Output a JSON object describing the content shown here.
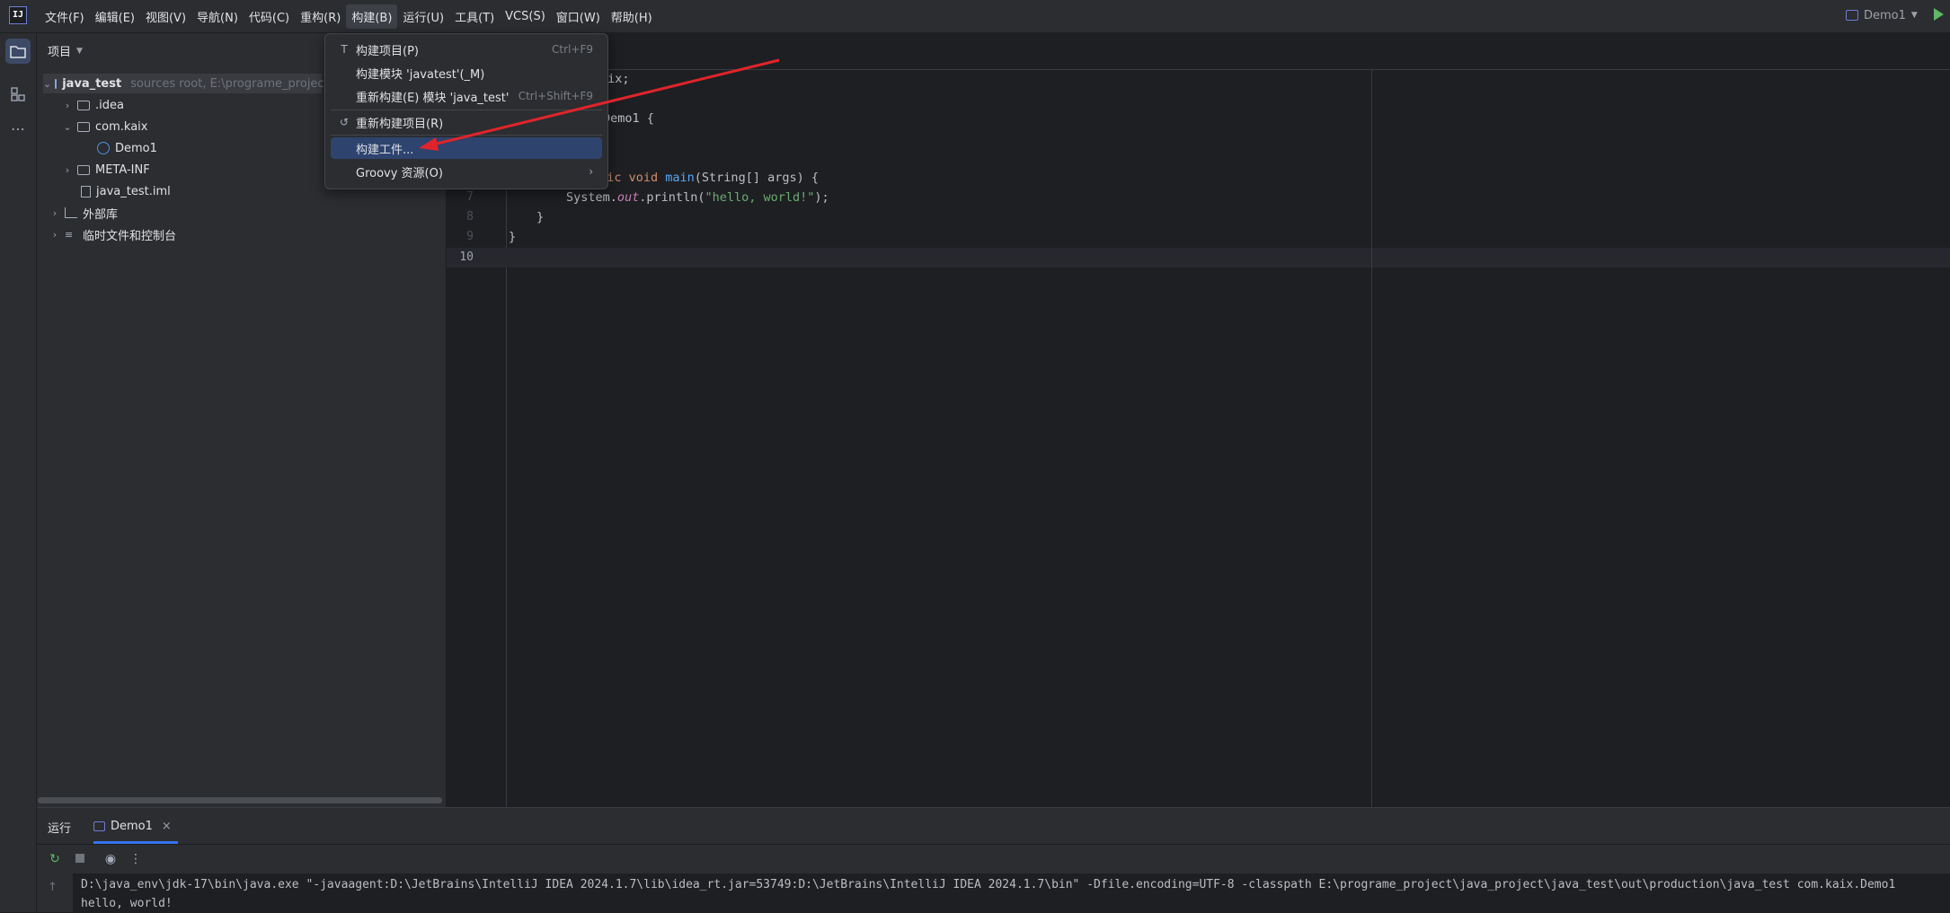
{
  "app": {
    "logo_text": "IJ"
  },
  "menu": {
    "items": [
      "文件(F)",
      "编辑(E)",
      "视图(V)",
      "导航(N)",
      "代码(C)",
      "重构(R)",
      "构建(B)",
      "运行(U)",
      "工具(T)",
      "VCS(S)",
      "窗口(W)",
      "帮助(H)"
    ],
    "active_index": 6
  },
  "run_config": {
    "label": "Demo1"
  },
  "project_panel": {
    "title": "项目",
    "tree": [
      {
        "label": "java_test",
        "hint": "sources root, E:\\programe_project\\",
        "depth": 0,
        "expanded": true,
        "icon": "module-folder-icon",
        "selected": true,
        "bold": true
      },
      {
        "label": ".idea",
        "depth": 1,
        "expanded": false,
        "icon": "folder-icon"
      },
      {
        "label": "com.kaix",
        "depth": 1,
        "expanded": true,
        "icon": "package-icon"
      },
      {
        "label": "Demo1",
        "depth": 2,
        "icon": "java-class-icon"
      },
      {
        "label": "META-INF",
        "depth": 1,
        "expanded": false,
        "icon": "folder-icon"
      },
      {
        "label": "java_test.iml",
        "depth": 1,
        "icon": "iml-file-icon"
      },
      {
        "label": "外部库",
        "depth": 0,
        "expanded": false,
        "icon": "library-icon"
      },
      {
        "label": "临时文件和控制台",
        "depth": 0,
        "expanded": false,
        "icon": "scratches-icon"
      }
    ]
  },
  "build_menu": {
    "items": [
      {
        "label": "构建项目(P)",
        "shortcut": "Ctrl+F9",
        "icon": "hammer-icon"
      },
      {
        "label": "构建模块 'javatest'(_M)",
        "shortcut": "",
        "icon": ""
      },
      {
        "label": "重新构建(E) 模块 'java_test'",
        "shortcut": "Ctrl+Shift+F9",
        "icon": ""
      },
      {
        "label": "重新构建项目(R)",
        "shortcut": "",
        "icon": "rebuild-icon"
      },
      {
        "label": "构建工件...",
        "shortcut": "",
        "icon": "",
        "highlighted": true
      },
      {
        "label": "Groovy 资源(O)",
        "shortcut": "",
        "icon": "",
        "submenu": true
      }
    ]
  },
  "editor": {
    "lines": [
      {
        "n": "",
        "text": "aix;"
      },
      {
        "n": "",
        "text": ""
      },
      {
        "n": "",
        "text": "Demo1 {"
      },
      {
        "n": "",
        "text": ""
      },
      {
        "n": "",
        "text": ""
      },
      {
        "n": "",
        "text": "atic void main(String[] args) {"
      },
      {
        "n": "7",
        "text": "System.out.println(\"hello, world!\");"
      },
      {
        "n": "8",
        "text": "}"
      },
      {
        "n": "9",
        "text": "}"
      },
      {
        "n": "10",
        "text": ""
      }
    ]
  },
  "run_panel": {
    "title": "运行",
    "tab_label": "Demo1",
    "console": [
      "D:\\java_env\\jdk-17\\bin\\java.exe \"-javaagent:D:\\JetBrains\\IntelliJ IDEA 2024.1.7\\lib\\idea_rt.jar=53749:D:\\JetBrains\\IntelliJ IDEA 2024.1.7\\bin\" -Dfile.encoding=UTF-8 -classpath E:\\programe_project\\java_project\\java_test\\out\\production\\java_test com.kaix.Demo1",
      "hello, world!"
    ]
  },
  "colors": {
    "accent": "#3574f0",
    "highlight": "#2e436e",
    "arrow": "#e0242b"
  }
}
